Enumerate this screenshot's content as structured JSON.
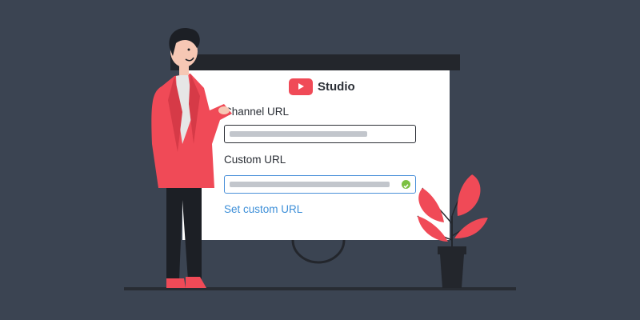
{
  "logo": {
    "text": "Studio",
    "icon": "play-icon",
    "color": "#f04a57"
  },
  "fields": [
    {
      "label": "Channel URL",
      "value_placeholder": ""
    },
    {
      "label": "Custom URL",
      "status": "valid"
    }
  ],
  "link": {
    "label": "Set custom URL"
  },
  "colors": {
    "background": "#3b4452",
    "accent": "#f04a57",
    "link": "#3d8fd8",
    "valid": "#7cc142"
  }
}
